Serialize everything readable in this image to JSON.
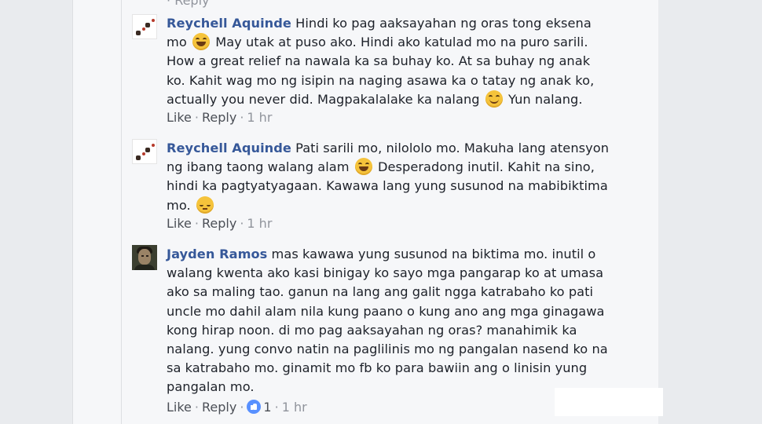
{
  "top_partial": {
    "label": "Reply"
  },
  "comments": [
    {
      "author": "Reychell Aquinde",
      "segments": [
        "Hindi ko pag aaksayahan ng oras tong eksena mo",
        "May utak at puso ako. Hindi ako katulad mo na puro sarili. How a great relief na nawala ka sa buhay ko. At sa buhay ng anak ko. Kahit wag mo ng isipin na naging asawa ka o tatay ng anak ko, actually you never did. Magpakalalake ka nalang",
        "Yun nalang."
      ],
      "emojis": [
        "grinning-emoji",
        "smiling-emoji"
      ],
      "actions": {
        "like": "Like",
        "reply": "Reply",
        "time": "1 hr"
      }
    },
    {
      "author": "Reychell Aquinde",
      "segments": [
        "Pati sarili mo, nilololo mo. Makuha lang atensyon ng ibang taong walang alam",
        "Desperadong inutil. Kahit na sino, hindi ka pagtyatyagaan. Kawawa lang yung susunod na mabibiktima mo."
      ],
      "emojis": [
        "grinning-emoji",
        "pensive-emoji"
      ],
      "actions": {
        "like": "Like",
        "reply": "Reply",
        "time": "1 hr"
      }
    },
    {
      "author": "Jayden Ramos",
      "segments": [
        "mas kawawa yung susunod na biktima mo. inutil o walang kwenta ako kasi binigay ko sayo mga pangarap ko at umasa ako sa maling tao. ganun na lang ang galit ngga katrabaho ko pati uncle mo dahil alam nila kung paano o kung ano ang mga ginagawa kong hirap noon. di mo pag aaksayahan ng oras? manahimik ka nalang. yung convo natin na paglilinis mo ng pangalan nasend ko na sa katrabaho mo. ginamit mo fb ko para bawiin ang o linisin yung pangalan mo."
      ],
      "actions": {
        "like": "Like",
        "reply": "Reply",
        "reaction_count": "1",
        "time": "1 hr"
      }
    }
  ],
  "colors": {
    "author": "#365899",
    "text": "#1d2129",
    "meta": "#90949c",
    "background": "#f6f7f9",
    "like_badge": "#5890ff"
  }
}
